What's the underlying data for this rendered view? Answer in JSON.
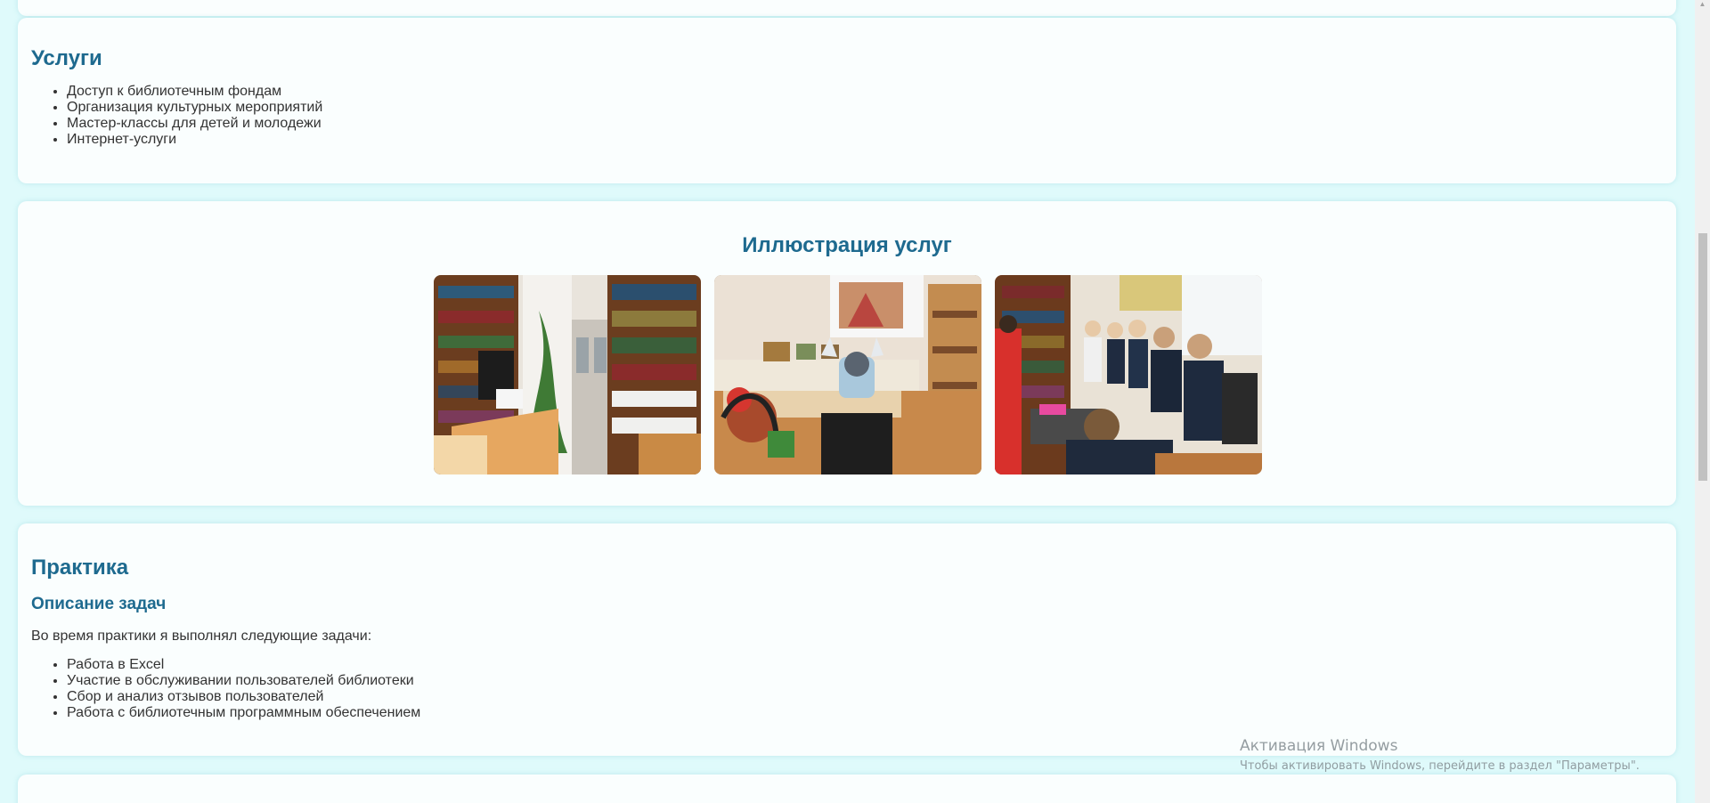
{
  "services": {
    "title": "Услуги",
    "items": [
      "Доступ к библиотечным фондам",
      "Организация культурных мероприятий",
      "Мастер-классы для детей и молодежи",
      "Интернет-услуги"
    ]
  },
  "illustration": {
    "title": "Иллюстрация услуг",
    "photos": [
      "library-shelves-photo",
      "children-event-photo",
      "school-group-photo"
    ]
  },
  "practice": {
    "title": "Практика",
    "subtitle": "Описание задач",
    "intro": "Во время практики я выполнял следующие задачи:",
    "items": [
      "Работа в Excel",
      "Участие в обслуживании пользователей библиотеки",
      "Сбор и анализ отзывов пользователей",
      "Работа с библиотечным программным обеспечением"
    ]
  },
  "watermark": {
    "title": "Активация Windows",
    "subtitle": "Чтобы активировать Windows, перейдите в раздел \"Параметры\"."
  },
  "colors": {
    "background": "#dffafb",
    "card": "#fafefe",
    "heading": "#1e6a8f",
    "text": "#333333"
  },
  "icons": {
    "scroll_up": "chevron-up-icon"
  }
}
